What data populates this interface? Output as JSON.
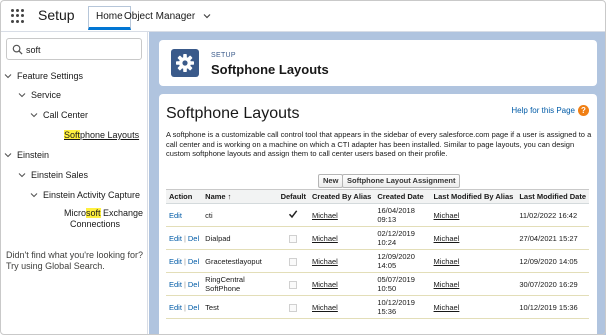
{
  "topbar": {
    "app_name": "Setup",
    "tabs": [
      {
        "label": "Home"
      },
      {
        "label": "Object Manager"
      }
    ]
  },
  "sidebar": {
    "search_value": "soft",
    "tree": [
      {
        "label": "Feature Settings"
      },
      {
        "label": "Service"
      },
      {
        "label": "Call Center"
      },
      {
        "label_pre": "",
        "label_hl": "Soft",
        "label_post": "phone Layouts"
      },
      {
        "label": "Einstein"
      },
      {
        "label": "Einstein Sales"
      },
      {
        "label": "Einstein Activity Capture"
      },
      {
        "label_pre": "Micro",
        "label_hl": "soft",
        "label_post": " Exchange",
        "label_line2": "Connections"
      }
    ],
    "help_text": "Didn't find what you're looking for? Try using Global Search."
  },
  "header": {
    "small_label": "SETUP",
    "title": "Softphone Layouts",
    "icon": "gear-icon"
  },
  "content": {
    "title": "Softphone Layouts",
    "help_link": "Help for this Page",
    "help_icon_glyph": "?",
    "description": "A softphone is a customizable call control tool that appears in the sidebar of every salesforce.com page if a user is assigned to a call center and is working on a machine on which a CTI adapter has been installed. Similar to page layouts, you can design custom softphone layouts and assign them to call center users based on their profile.",
    "buttons": {
      "new": "New",
      "assignment": "Softphone Layout Assignment"
    },
    "columns": [
      "Action",
      "Name ↑",
      "Default",
      "Created By Alias",
      "Created Date",
      "Last Modified By Alias",
      "Last Modified Date"
    ],
    "action_labels": {
      "edit": "Edit",
      "del": "Del",
      "sep": "|"
    },
    "rows": [
      {
        "has_del": false,
        "name": "cti",
        "default": true,
        "created_by": "Michael",
        "created_date": "16/04/2018 09:13",
        "modified_by": "Michael",
        "modified_date": "11/02/2022 16:42"
      },
      {
        "has_del": true,
        "name": "Dialpad",
        "default": false,
        "created_by": "Michael",
        "created_date": "02/12/2019 10:24",
        "modified_by": "Michael",
        "modified_date": "27/04/2021 15:27"
      },
      {
        "has_del": true,
        "name": "Gracetestlayoput",
        "default": false,
        "created_by": "Michael",
        "created_date": "12/09/2020 14:05",
        "modified_by": "Michael",
        "modified_date": "12/09/2020 14:05"
      },
      {
        "has_del": true,
        "name": "RingCentral SoftPhone",
        "default": false,
        "created_by": "Michael",
        "created_date": "05/07/2019 10:50",
        "modified_by": "Michael",
        "modified_date": "30/07/2020 16:29"
      },
      {
        "has_del": true,
        "name": "Test",
        "default": false,
        "created_by": "Michael",
        "created_date": "10/12/2019 15:36",
        "modified_by": "Michael",
        "modified_date": "10/12/2019 15:36"
      }
    ]
  },
  "colors": {
    "accent": "#0176d3",
    "main_bg": "#b0c4df",
    "header_icon_bg": "#3a5a8a",
    "link": "#015ba7",
    "help_orange": "#f07f14",
    "highlight": "#fff03f"
  }
}
